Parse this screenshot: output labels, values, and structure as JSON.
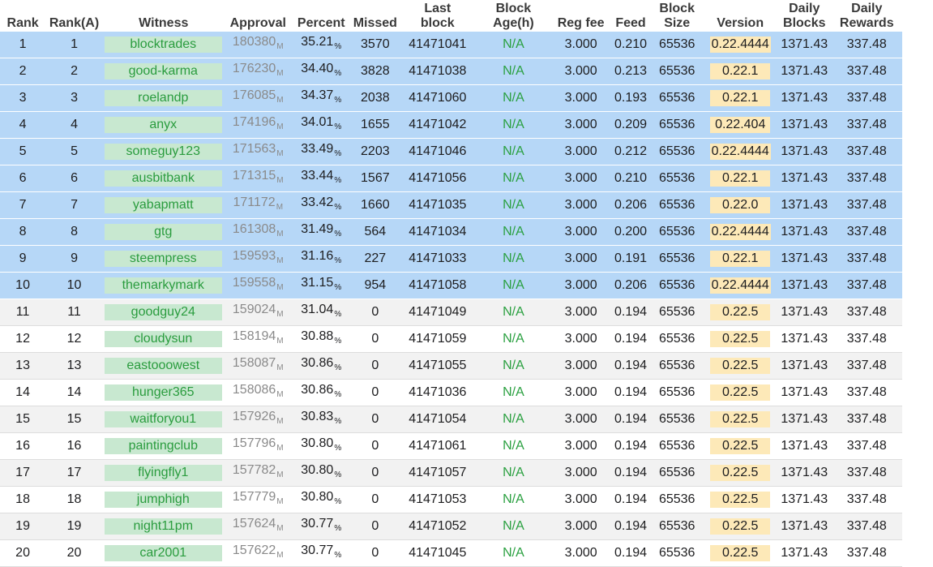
{
  "headers": {
    "rank": [
      "Rank"
    ],
    "rank_a": [
      "Rank(A)"
    ],
    "witness": [
      "Witness"
    ],
    "approval": [
      "Approval"
    ],
    "percent": [
      "Percent"
    ],
    "missed": [
      "Missed"
    ],
    "last_block": [
      "Last",
      "block"
    ],
    "block_age": [
      "Block",
      "Age(h)"
    ],
    "reg_fee": [
      "Reg fee"
    ],
    "feed": [
      "Feed"
    ],
    "block_size": [
      "Block",
      "Size"
    ],
    "version": [
      "Version"
    ],
    "daily_blocks": [
      "Daily",
      "Blocks"
    ],
    "daily_rewards": [
      "Daily",
      "Rewards"
    ]
  },
  "approval_unit": "M",
  "percent_unit": "%",
  "colors": {
    "top_row_bg": "#b6d7f7",
    "witness_bg": "#c8e8d0",
    "witness_text": "#2a9c3e",
    "version_bg": "#fde9b8",
    "na_text": "#2aa040"
  },
  "rows": [
    {
      "rank": "1",
      "rank_a": "1",
      "witness": "blocktrades",
      "approval": "180380",
      "percent": "35.21",
      "missed": "3570",
      "last_block": "41471041",
      "block_age": "N/A",
      "reg_fee": "3.000",
      "feed": "0.210",
      "block_size": "65536",
      "version": "0.22.4444",
      "daily_blocks": "1371.43",
      "daily_rewards": "337.48",
      "top": true
    },
    {
      "rank": "2",
      "rank_a": "2",
      "witness": "good-karma",
      "approval": "176230",
      "percent": "34.40",
      "missed": "3828",
      "last_block": "41471038",
      "block_age": "N/A",
      "reg_fee": "3.000",
      "feed": "0.213",
      "block_size": "65536",
      "version": "0.22.1",
      "daily_blocks": "1371.43",
      "daily_rewards": "337.48",
      "top": true
    },
    {
      "rank": "3",
      "rank_a": "3",
      "witness": "roelandp",
      "approval": "176085",
      "percent": "34.37",
      "missed": "2038",
      "last_block": "41471060",
      "block_age": "N/A",
      "reg_fee": "3.000",
      "feed": "0.193",
      "block_size": "65536",
      "version": "0.22.1",
      "daily_blocks": "1371.43",
      "daily_rewards": "337.48",
      "top": true
    },
    {
      "rank": "4",
      "rank_a": "4",
      "witness": "anyx",
      "approval": "174196",
      "percent": "34.01",
      "missed": "1655",
      "last_block": "41471042",
      "block_age": "N/A",
      "reg_fee": "3.000",
      "feed": "0.209",
      "block_size": "65536",
      "version": "0.22.404",
      "daily_blocks": "1371.43",
      "daily_rewards": "337.48",
      "top": true
    },
    {
      "rank": "5",
      "rank_a": "5",
      "witness": "someguy123",
      "approval": "171563",
      "percent": "33.49",
      "missed": "2203",
      "last_block": "41471046",
      "block_age": "N/A",
      "reg_fee": "3.000",
      "feed": "0.212",
      "block_size": "65536",
      "version": "0.22.4444",
      "daily_blocks": "1371.43",
      "daily_rewards": "337.48",
      "top": true
    },
    {
      "rank": "6",
      "rank_a": "6",
      "witness": "ausbitbank",
      "approval": "171315",
      "percent": "33.44",
      "missed": "1567",
      "last_block": "41471056",
      "block_age": "N/A",
      "reg_fee": "3.000",
      "feed": "0.210",
      "block_size": "65536",
      "version": "0.22.1",
      "daily_blocks": "1371.43",
      "daily_rewards": "337.48",
      "top": true
    },
    {
      "rank": "7",
      "rank_a": "7",
      "witness": "yabapmatt",
      "approval": "171172",
      "percent": "33.42",
      "missed": "1660",
      "last_block": "41471035",
      "block_age": "N/A",
      "reg_fee": "3.000",
      "feed": "0.206",
      "block_size": "65536",
      "version": "0.22.0",
      "daily_blocks": "1371.43",
      "daily_rewards": "337.48",
      "top": true
    },
    {
      "rank": "8",
      "rank_a": "8",
      "witness": "gtg",
      "approval": "161308",
      "percent": "31.49",
      "missed": "564",
      "last_block": "41471034",
      "block_age": "N/A",
      "reg_fee": "3.000",
      "feed": "0.200",
      "block_size": "65536",
      "version": "0.22.4444",
      "daily_blocks": "1371.43",
      "daily_rewards": "337.48",
      "top": true
    },
    {
      "rank": "9",
      "rank_a": "9",
      "witness": "steempress",
      "approval": "159593",
      "percent": "31.16",
      "missed": "227",
      "last_block": "41471033",
      "block_age": "N/A",
      "reg_fee": "3.000",
      "feed": "0.191",
      "block_size": "65536",
      "version": "0.22.1",
      "daily_blocks": "1371.43",
      "daily_rewards": "337.48",
      "top": true
    },
    {
      "rank": "10",
      "rank_a": "10",
      "witness": "themarkymark",
      "approval": "159558",
      "percent": "31.15",
      "missed": "954",
      "last_block": "41471058",
      "block_age": "N/A",
      "reg_fee": "3.000",
      "feed": "0.206",
      "block_size": "65536",
      "version": "0.22.4444",
      "daily_blocks": "1371.43",
      "daily_rewards": "337.48",
      "top": true
    },
    {
      "rank": "11",
      "rank_a": "11",
      "witness": "goodguy24",
      "approval": "159024",
      "percent": "31.04",
      "missed": "0",
      "last_block": "41471049",
      "block_age": "N/A",
      "reg_fee": "3.000",
      "feed": "0.194",
      "block_size": "65536",
      "version": "0.22.5",
      "daily_blocks": "1371.43",
      "daily_rewards": "337.48",
      "top": false
    },
    {
      "rank": "12",
      "rank_a": "12",
      "witness": "cloudysun",
      "approval": "158194",
      "percent": "30.88",
      "missed": "0",
      "last_block": "41471059",
      "block_age": "N/A",
      "reg_fee": "3.000",
      "feed": "0.194",
      "block_size": "65536",
      "version": "0.22.5",
      "daily_blocks": "1371.43",
      "daily_rewards": "337.48",
      "top": false
    },
    {
      "rank": "13",
      "rank_a": "13",
      "witness": "eastooowest",
      "approval": "158087",
      "percent": "30.86",
      "missed": "0",
      "last_block": "41471055",
      "block_age": "N/A",
      "reg_fee": "3.000",
      "feed": "0.194",
      "block_size": "65536",
      "version": "0.22.5",
      "daily_blocks": "1371.43",
      "daily_rewards": "337.48",
      "top": false
    },
    {
      "rank": "14",
      "rank_a": "14",
      "witness": "hunger365",
      "approval": "158086",
      "percent": "30.86",
      "missed": "0",
      "last_block": "41471036",
      "block_age": "N/A",
      "reg_fee": "3.000",
      "feed": "0.194",
      "block_size": "65536",
      "version": "0.22.5",
      "daily_blocks": "1371.43",
      "daily_rewards": "337.48",
      "top": false
    },
    {
      "rank": "15",
      "rank_a": "15",
      "witness": "waitforyou1",
      "approval": "157926",
      "percent": "30.83",
      "missed": "0",
      "last_block": "41471054",
      "block_age": "N/A",
      "reg_fee": "3.000",
      "feed": "0.194",
      "block_size": "65536",
      "version": "0.22.5",
      "daily_blocks": "1371.43",
      "daily_rewards": "337.48",
      "top": false
    },
    {
      "rank": "16",
      "rank_a": "16",
      "witness": "paintingclub",
      "approval": "157796",
      "percent": "30.80",
      "missed": "0",
      "last_block": "41471061",
      "block_age": "N/A",
      "reg_fee": "3.000",
      "feed": "0.194",
      "block_size": "65536",
      "version": "0.22.5",
      "daily_blocks": "1371.43",
      "daily_rewards": "337.48",
      "top": false
    },
    {
      "rank": "17",
      "rank_a": "17",
      "witness": "flyingfly1",
      "approval": "157782",
      "percent": "30.80",
      "missed": "0",
      "last_block": "41471057",
      "block_age": "N/A",
      "reg_fee": "3.000",
      "feed": "0.194",
      "block_size": "65536",
      "version": "0.22.5",
      "daily_blocks": "1371.43",
      "daily_rewards": "337.48",
      "top": false
    },
    {
      "rank": "18",
      "rank_a": "18",
      "witness": "jumphigh",
      "approval": "157779",
      "percent": "30.80",
      "missed": "0",
      "last_block": "41471053",
      "block_age": "N/A",
      "reg_fee": "3.000",
      "feed": "0.194",
      "block_size": "65536",
      "version": "0.22.5",
      "daily_blocks": "1371.43",
      "daily_rewards": "337.48",
      "top": false
    },
    {
      "rank": "19",
      "rank_a": "19",
      "witness": "night11pm",
      "approval": "157624",
      "percent": "30.77",
      "missed": "0",
      "last_block": "41471052",
      "block_age": "N/A",
      "reg_fee": "3.000",
      "feed": "0.194",
      "block_size": "65536",
      "version": "0.22.5",
      "daily_blocks": "1371.43",
      "daily_rewards": "337.48",
      "top": false
    },
    {
      "rank": "20",
      "rank_a": "20",
      "witness": "car2001",
      "approval": "157622",
      "percent": "30.77",
      "missed": "0",
      "last_block": "41471045",
      "block_age": "N/A",
      "reg_fee": "3.000",
      "feed": "0.194",
      "block_size": "65536",
      "version": "0.22.5",
      "daily_blocks": "1371.43",
      "daily_rewards": "337.48",
      "top": false
    }
  ]
}
